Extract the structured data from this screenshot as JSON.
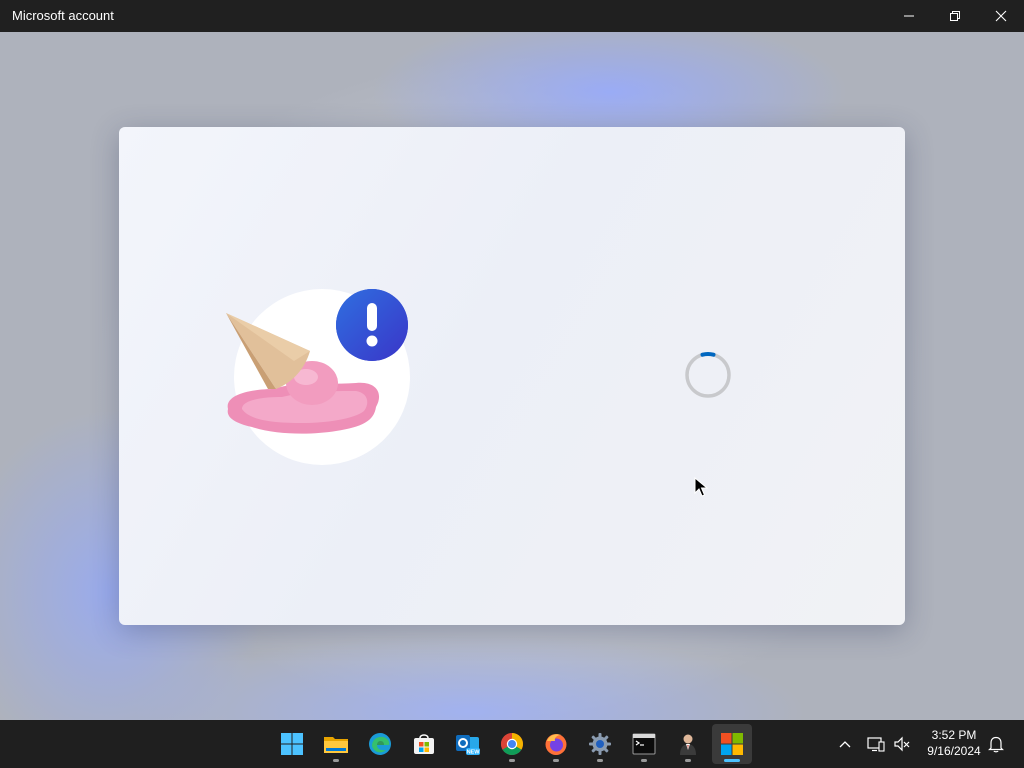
{
  "window": {
    "title": "Microsoft account",
    "controls": [
      "minimize",
      "restore",
      "close"
    ]
  },
  "content": {
    "illustration_icon": "melted-ice-cream-error-icon",
    "status_icon": "loading-spinner"
  },
  "taskbar": {
    "apps": [
      {
        "name": "start-button",
        "icon": "windows-logo-icon",
        "running": false
      },
      {
        "name": "file-explorer",
        "icon": "folder-icon",
        "running": true
      },
      {
        "name": "edge",
        "icon": "edge-icon",
        "running": false
      },
      {
        "name": "microsoft-store",
        "icon": "store-icon",
        "running": false
      },
      {
        "name": "outlook-new",
        "icon": "outlook-icon",
        "running": false
      },
      {
        "name": "chrome",
        "icon": "chrome-icon",
        "running": true
      },
      {
        "name": "firefox",
        "icon": "firefox-icon",
        "running": true
      },
      {
        "name": "settings",
        "icon": "gear-icon",
        "running": true
      },
      {
        "name": "terminal",
        "icon": "terminal-icon",
        "running": true
      },
      {
        "name": "user-app",
        "icon": "person-icon",
        "running": true
      },
      {
        "name": "microsoft-account",
        "icon": "microsoft-logo-icon",
        "running": true,
        "active": true
      }
    ],
    "tray": {
      "overflow_icon": "chevron-up-icon",
      "network_icon": "network-icon",
      "volume_icon": "volume-muted-icon",
      "notification_icon": "bell-icon"
    },
    "clock": {
      "time": "3:52 PM",
      "date": "9/16/2024"
    }
  },
  "colors": {
    "titlebar": "#202020",
    "taskbar": "#1f1f1f",
    "accent": "#0067c0",
    "error_badge": "#3a4fd8"
  }
}
